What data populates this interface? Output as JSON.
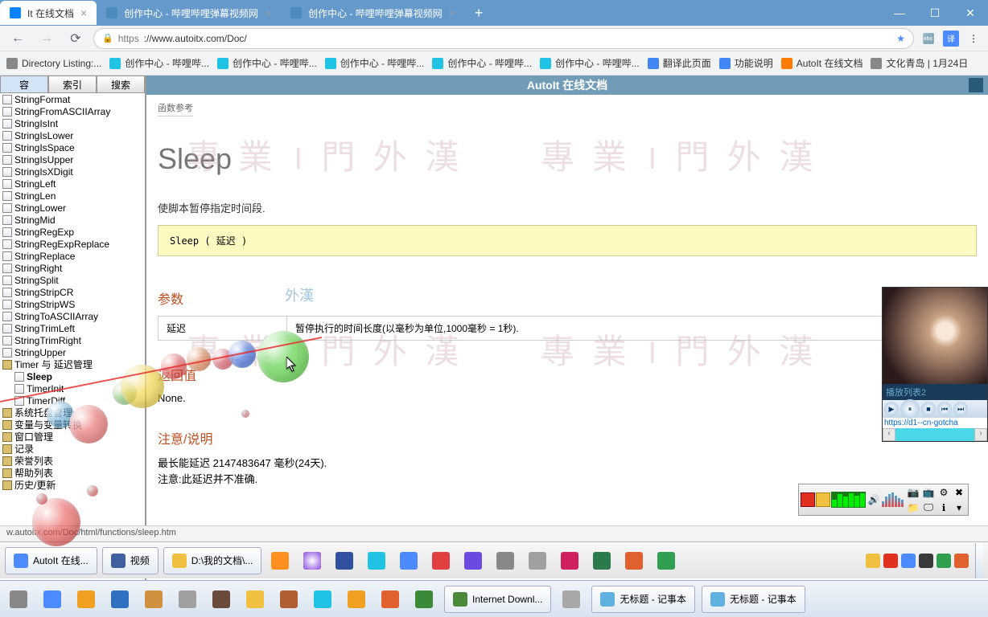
{
  "tabs": [
    {
      "label": "It 在线文档",
      "active": true
    },
    {
      "label": "创作中心 - 哔哩哔哩弹幕视频网",
      "active": false
    },
    {
      "label": "创作中心 - 哔哩哔哩弹幕视频网",
      "active": false
    }
  ],
  "url": {
    "scheme": "https",
    "host": "://www.autoitx.com/Doc/"
  },
  "bookmarks": [
    {
      "label": "Directory Listing:..."
    },
    {
      "label": "创作中心 - 哔哩哔..."
    },
    {
      "label": "创作中心 - 哔哩哔..."
    },
    {
      "label": "创作中心 - 哔哩哔..."
    },
    {
      "label": "创作中心 - 哔哩哔..."
    },
    {
      "label": "创作中心 - 哔哩哔..."
    },
    {
      "label": "翻译此页面"
    },
    {
      "label": "功能说明"
    },
    {
      "label": "AutoIt 在线文档"
    },
    {
      "label": "文化青岛 | 1月24日"
    }
  ],
  "sidebar": {
    "tabs": [
      "容",
      "索引",
      "搜索"
    ],
    "items": [
      "StringFormat",
      "StringFromASCIIArray",
      "StringIsInt",
      "StringIsLower",
      "StringIsSpace",
      "StringIsUpper",
      "StringIsXDigit",
      "StringLeft",
      "StringLen",
      "StringLower",
      "StringMid",
      "StringRegExp",
      "StringRegExpReplace",
      "StringReplace",
      "StringRight",
      "StringSplit",
      "StringStripCR",
      "StringStripWS",
      "StringToASCIIArray",
      "StringTrimLeft",
      "StringTrimRight",
      "StringUpper"
    ],
    "book_timer": "Timer 与 延迟管理",
    "timer_children": [
      "Sleep",
      "TimerInit",
      "TimerDiff"
    ],
    "after": [
      "系统托盘管理",
      "变量与变量转换",
      "窗口管理",
      "记录",
      "荣誉列表",
      "帮助列表",
      "历史/更新"
    ]
  },
  "doc": {
    "title_bar": "AutoIt 在线文档",
    "crumb": "函数参考",
    "fn": "Sleep",
    "desc": "使脚本暂停指定时间段.",
    "code": "Sleep ( 延迟 )",
    "sec_params": "参数",
    "param_name": "延迟",
    "param_desc": "暂停执行的时间长度(以毫秒为单位,1000毫秒 = 1秒).",
    "sec_return": "返回值",
    "return_text": "None.",
    "sec_remarks": "注意/说明",
    "remark1": "最长能延迟 2147483647 毫秒(24天).",
    "remark2": "注意:此延迟并不准确.",
    "watermark": "專 業 । 門 外 漢",
    "wm_small": "外漢"
  },
  "statusbar": "w.autoitx.com/Doc/html/functions/sleep.htm",
  "media": {
    "playlist": "播放列表2",
    "url": "https://d1--cn-gotcha"
  },
  "task1": [
    {
      "label": "AutoIt 在线..."
    },
    {
      "label": "视频"
    },
    {
      "label": "D:\\我的文档\\..."
    }
  ],
  "task2": [
    {
      "label": "Internet Downl..."
    },
    {
      "label": "无标题 - 记事本"
    },
    {
      "label": "无标题 - 记事本"
    }
  ]
}
